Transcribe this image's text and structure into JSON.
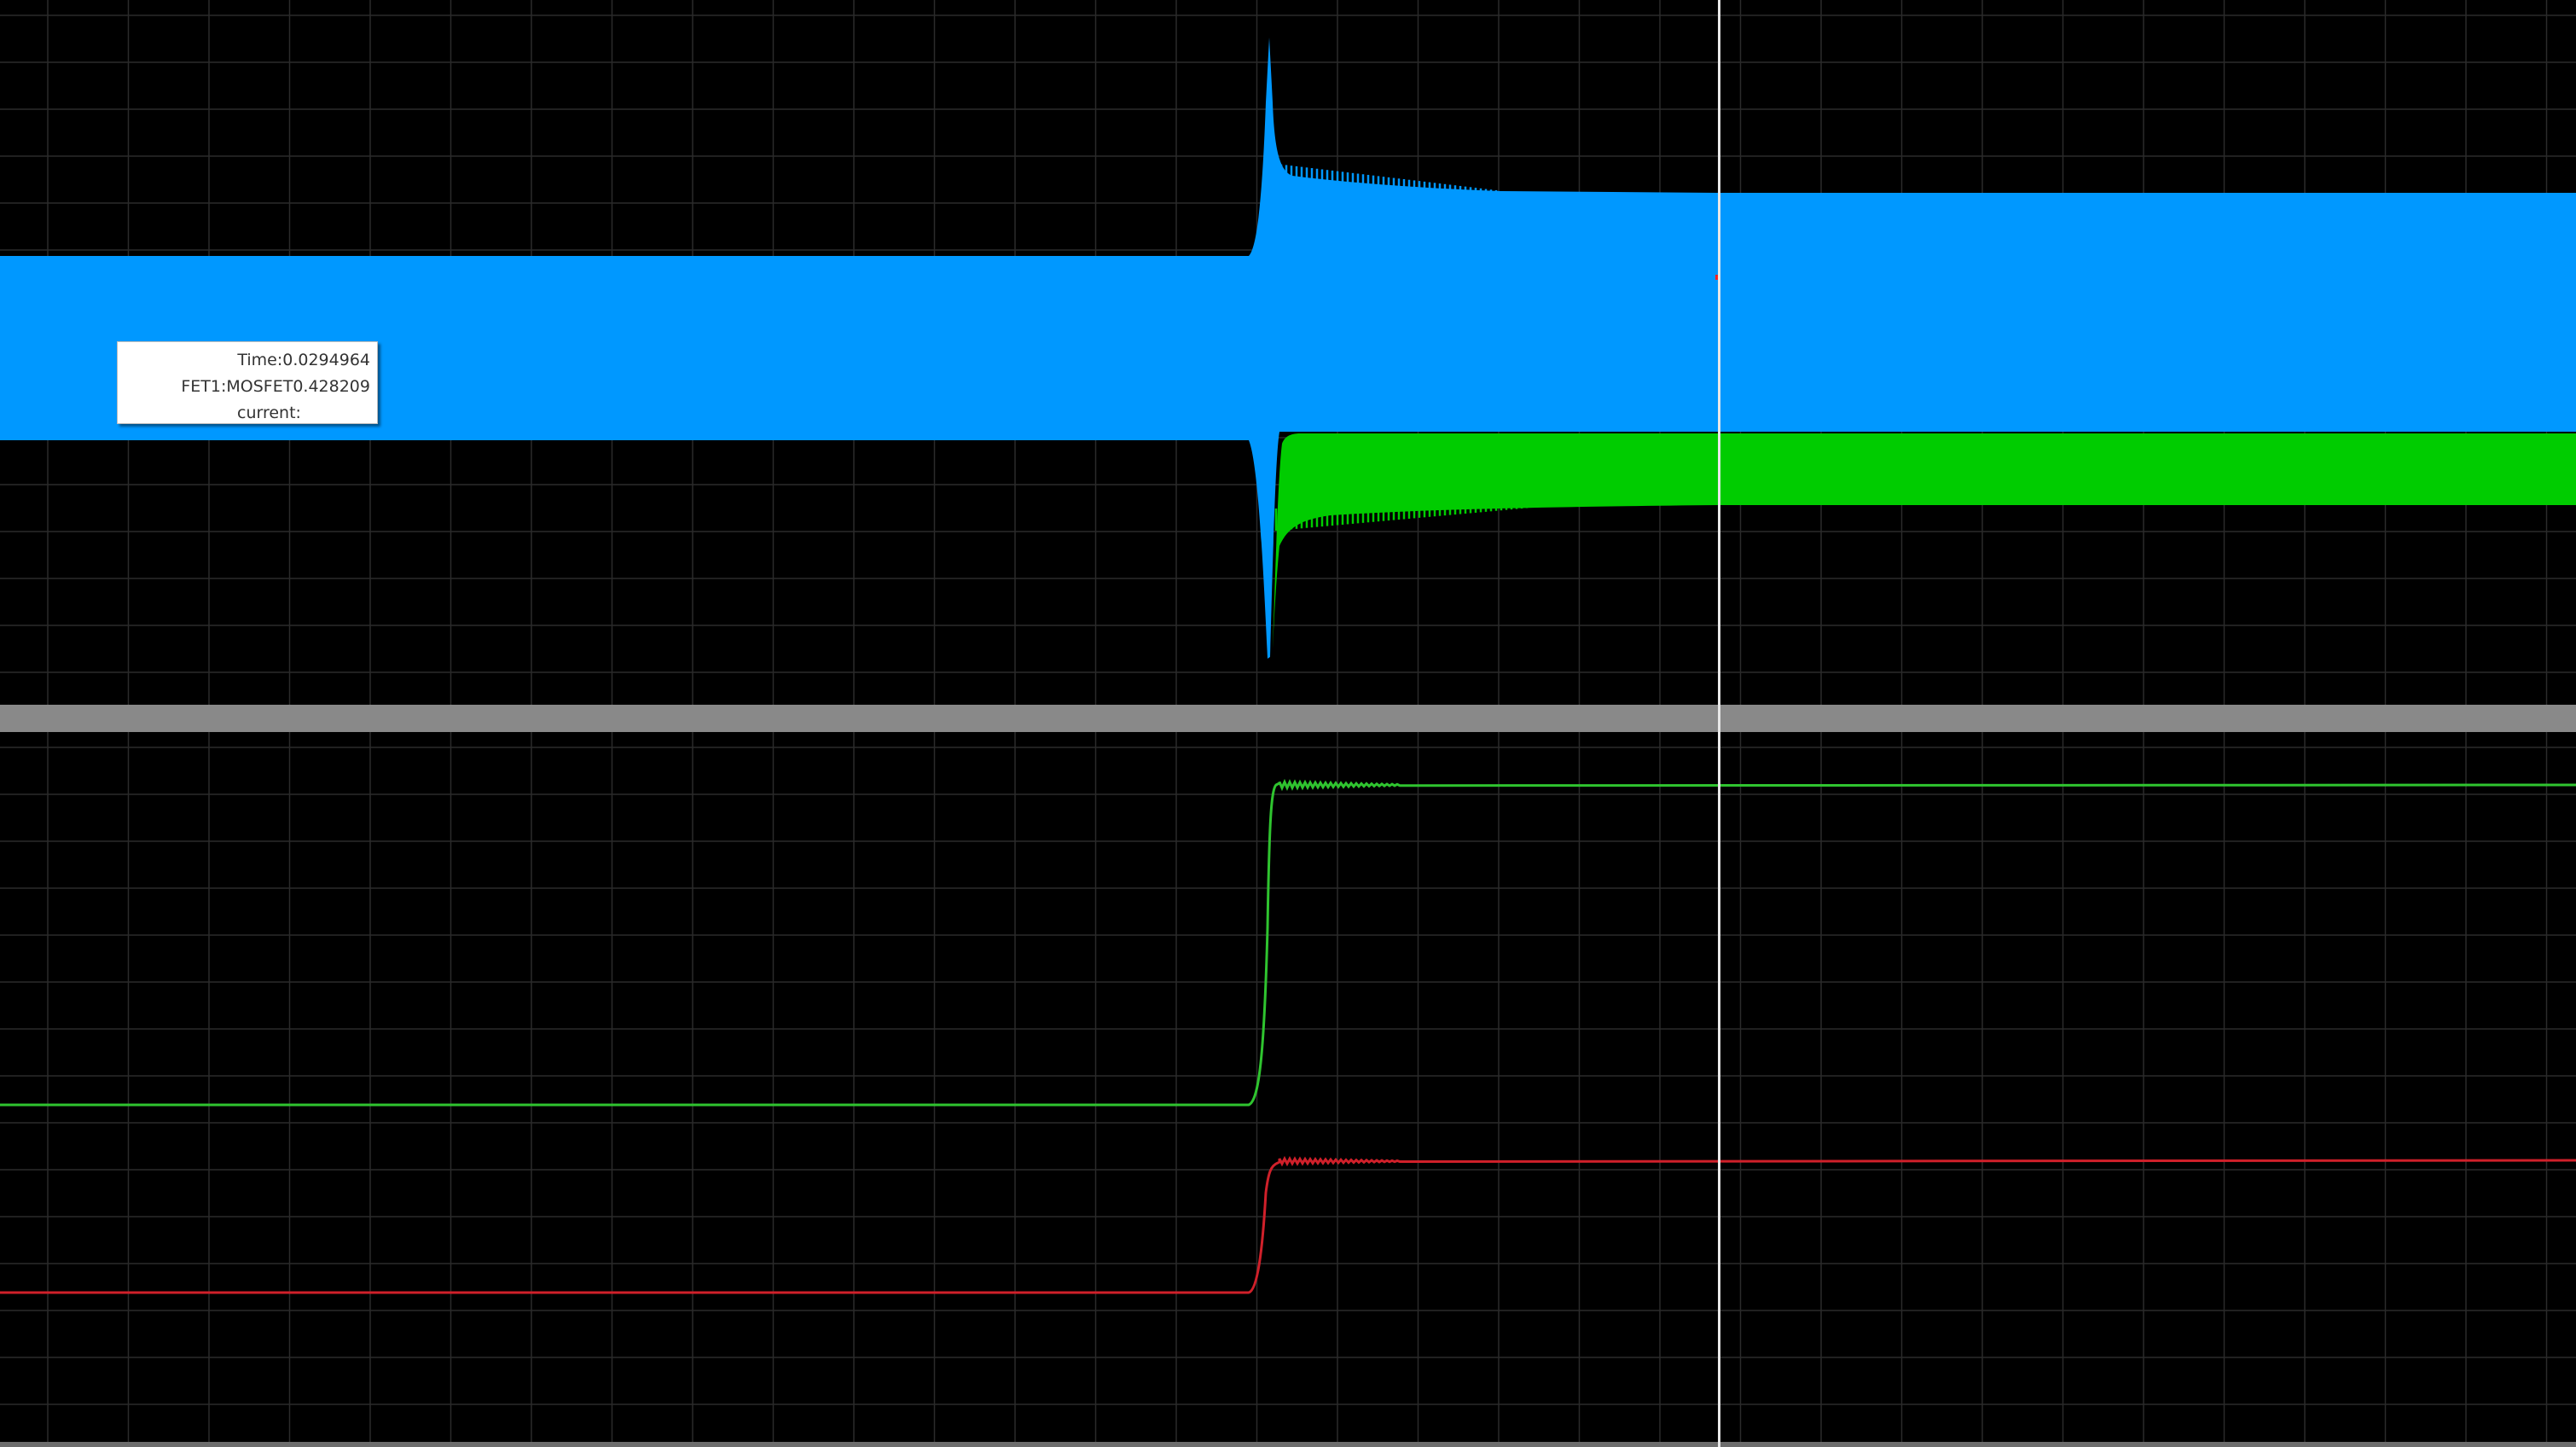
{
  "colors": {
    "background": "#000000",
    "grid": "#2b2b2b",
    "splitter": "#898989",
    "cursor": "#e8e8e8",
    "blue_trace": "#0098ff",
    "green_trace": "#00cc00",
    "green_line": "#2fc42f",
    "red_line": "#d0202a",
    "marker": "#ff2020"
  },
  "tooltip": {
    "time_label": "Time:",
    "time_value": "0.0294964",
    "signal_label": "FET1:MOSFET",
    "signal_value": "0.428209",
    "signal_label_2": "current:"
  },
  "cursor": {
    "time": 0.0294964
  },
  "chart_data": [
    {
      "type": "line",
      "pane": "top",
      "grid": true,
      "series": [
        {
          "color": "#0098ff",
          "style": "filled-oscillation-envelope",
          "steps_up_at_transient": true
        },
        {
          "color": "#00cc00",
          "style": "filled-oscillation-envelope",
          "appears_after_transient": true
        }
      ]
    },
    {
      "type": "line",
      "pane": "bottom",
      "grid": true,
      "series": [
        {
          "color": "#2fc42f",
          "style": "step-response"
        },
        {
          "color": "#d0202a",
          "style": "step-response"
        }
      ]
    }
  ]
}
